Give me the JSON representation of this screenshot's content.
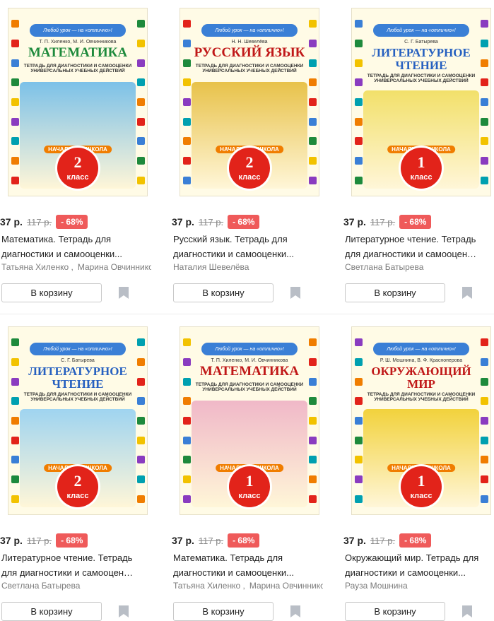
{
  "ui": {
    "add_to_cart": "В корзину"
  },
  "cover_common": {
    "slogan": "Любой урок — на «отлично»!",
    "subtitle": "ТЕТРАДЬ ДЛЯ ДИАГНОСТИКИ И САМООЦЕНКИ УНИВЕРСАЛЬНЫХ УЧЕБНЫХ ДЕЙСТВИЙ",
    "school": "НАЧАЛЬНАЯ ШКОЛА",
    "grade_word": "класс"
  },
  "products": [
    {
      "cover": {
        "authors": "Т. П. Хиленко, М. И. Овчинникова",
        "title": "МАТЕМАТИКА",
        "grade": "2",
        "color": "#1e8a3c",
        "art": "#7cc1e8"
      },
      "price": "37 р.",
      "old_price": "117 р.",
      "discount": "- 68%",
      "name_line1": "Математика. Тетрадь для",
      "name_line2": "диагностики и самооценки...",
      "authors": [
        "Татьяна Хиленко ,",
        "Марина Овчинникова"
      ]
    },
    {
      "cover": {
        "authors": "Н. Н. Шевелёва",
        "title": "РУССКИЙ ЯЗЫК",
        "grade": "2",
        "color": "#c01818",
        "art": "#e8c24a"
      },
      "price": "37 р.",
      "old_price": "117 р.",
      "discount": "- 68%",
      "name_line1": "Русский язык. Тетрадь для",
      "name_line2": "диагностики и самооценки...",
      "authors": [
        "Наталия Шевелёва"
      ]
    },
    {
      "cover": {
        "authors": "С. Г. Батырева",
        "title": "ЛИТЕРАТУРНОЕ ЧТЕНИЕ",
        "grade": "1",
        "color": "#2660c0",
        "art": "#f2e06a"
      },
      "price": "37 р.",
      "old_price": "117 р.",
      "discount": "- 68%",
      "name_line1": "Литературное чтение. Тетрадь",
      "name_line2": "для диагностики и самооценки...",
      "authors": [
        "Светлана Батырева"
      ]
    },
    {
      "cover": {
        "authors": "С. Г. Батырева",
        "title": "ЛИТЕРАТУРНОЕ ЧТЕНИЕ",
        "grade": "2",
        "color": "#2660c0",
        "art": "#9fd4f0"
      },
      "price": "37 р.",
      "old_price": "117 р.",
      "discount": "- 68%",
      "name_line1": "Литературное чтение. Тетрадь",
      "name_line2": "для диагностики и самооценки...",
      "authors": [
        "Светлана Батырева"
      ]
    },
    {
      "cover": {
        "authors": "Т. П. Хиленко, М. И. Овчинникова",
        "title": "МАТЕМАТИКА",
        "grade": "1",
        "color": "#c01818",
        "art": "#f0b8c8"
      },
      "price": "37 р.",
      "old_price": "117 р.",
      "discount": "- 68%",
      "name_line1": "Математика. Тетрадь для",
      "name_line2": "диагностики и самооценки...",
      "authors": [
        "Татьяна Хиленко ,",
        "Марина Овчинникова"
      ]
    },
    {
      "cover": {
        "authors": "Р. Ш. Мошнина, В. Ф. Красноперова",
        "title": "ОКРУЖАЮЩИЙ МИР",
        "grade": "1",
        "color": "#c01818",
        "art": "#f2d23c"
      },
      "price": "37 р.",
      "old_price": "117 р.",
      "discount": "- 68%",
      "name_line1": "Окружающий мир. Тетрадь для",
      "name_line2": "диагностики и самооценки...",
      "authors": [
        "Рауза Мошнина"
      ]
    }
  ]
}
